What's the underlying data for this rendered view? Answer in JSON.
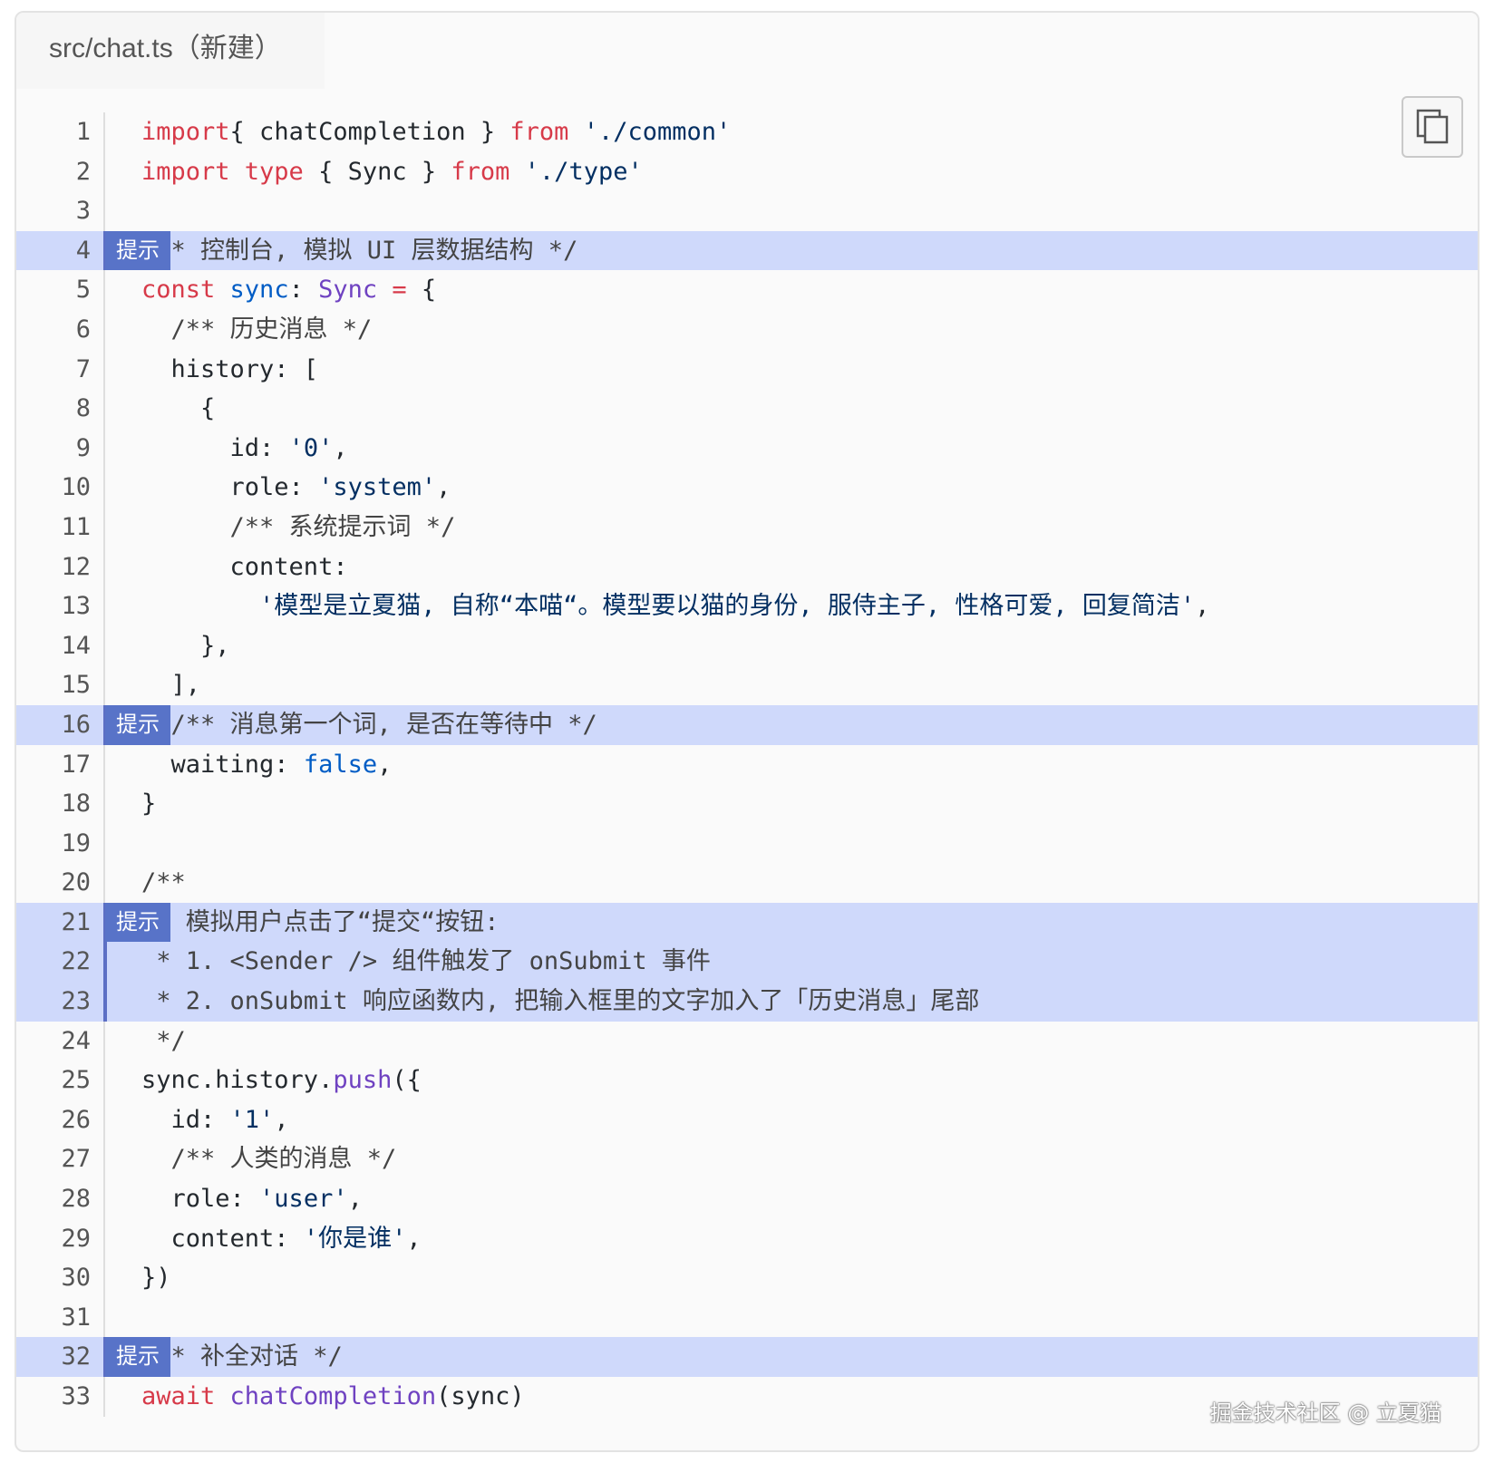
{
  "tab": {
    "title": "src/chat.ts（新建）"
  },
  "copy_button": {
    "icon": "copy-icon"
  },
  "badge_label": "提示",
  "lines": [
    {
      "n": "1",
      "hl": false,
      "badge": false,
      "parts": [
        [
          "kw",
          "import"
        ],
        [
          "",
          "{ chatCompletion } "
        ],
        [
          "kw",
          "from"
        ],
        [
          "",
          " "
        ],
        [
          "str",
          "'./common'"
        ]
      ]
    },
    {
      "n": "2",
      "hl": false,
      "badge": false,
      "parts": [
        [
          "kw",
          "import type"
        ],
        [
          "",
          " { Sync } "
        ],
        [
          "kw",
          "from"
        ],
        [
          "",
          " "
        ],
        [
          "str",
          "'./type'"
        ]
      ]
    },
    {
      "n": "3",
      "hl": false,
      "badge": false,
      "parts": []
    },
    {
      "n": "4",
      "hl": true,
      "badge": true,
      "parts": [
        [
          "cmt",
          "/** 控制台, 模拟 UI 层数据结构 */"
        ]
      ]
    },
    {
      "n": "5",
      "hl": false,
      "badge": false,
      "parts": [
        [
          "kw",
          "const"
        ],
        [
          "",
          " "
        ],
        [
          "var",
          "sync"
        ],
        [
          "",
          ": "
        ],
        [
          "cls",
          "Sync"
        ],
        [
          "",
          " "
        ],
        [
          "kw",
          "="
        ],
        [
          "",
          " {"
        ]
      ]
    },
    {
      "n": "6",
      "hl": false,
      "badge": false,
      "parts": [
        [
          "cmt",
          "  /** 历史消息 */"
        ]
      ]
    },
    {
      "n": "7",
      "hl": false,
      "badge": false,
      "parts": [
        [
          "",
          "  history: ["
        ]
      ]
    },
    {
      "n": "8",
      "hl": false,
      "badge": false,
      "parts": [
        [
          "",
          "    {"
        ]
      ]
    },
    {
      "n": "9",
      "hl": false,
      "badge": false,
      "parts": [
        [
          "",
          "      id: "
        ],
        [
          "str",
          "'0'"
        ],
        [
          "",
          ","
        ]
      ]
    },
    {
      "n": "10",
      "hl": false,
      "badge": false,
      "parts": [
        [
          "",
          "      role: "
        ],
        [
          "str",
          "'system'"
        ],
        [
          "",
          ","
        ]
      ]
    },
    {
      "n": "11",
      "hl": false,
      "badge": false,
      "parts": [
        [
          "cmt",
          "      /** 系统提示词 */"
        ]
      ]
    },
    {
      "n": "12",
      "hl": false,
      "badge": false,
      "parts": [
        [
          "",
          "      content:"
        ]
      ]
    },
    {
      "n": "13",
      "hl": false,
      "badge": false,
      "parts": [
        [
          "str",
          "        '模型是立夏猫, 自称“本喵“。模型要以猫的身份, 服侍主子, 性格可爱, 回复简洁'"
        ],
        [
          "",
          ","
        ]
      ]
    },
    {
      "n": "14",
      "hl": false,
      "badge": false,
      "parts": [
        [
          "",
          "    },"
        ]
      ]
    },
    {
      "n": "15",
      "hl": false,
      "badge": false,
      "parts": [
        [
          "",
          "  ],"
        ]
      ]
    },
    {
      "n": "16",
      "hl": true,
      "badge": true,
      "parts": [
        [
          "cmt",
          "  /** 消息第一个词, 是否在等待中 */"
        ]
      ]
    },
    {
      "n": "17",
      "hl": false,
      "badge": false,
      "parts": [
        [
          "",
          "  waiting: "
        ],
        [
          "var",
          "false"
        ],
        [
          "",
          ","
        ]
      ]
    },
    {
      "n": "18",
      "hl": false,
      "badge": false,
      "parts": [
        [
          "",
          "}"
        ]
      ]
    },
    {
      "n": "19",
      "hl": false,
      "badge": false,
      "parts": []
    },
    {
      "n": "20",
      "hl": false,
      "badge": false,
      "parts": [
        [
          "cmt",
          "/**"
        ]
      ]
    },
    {
      "n": "21",
      "hl": true,
      "badge": true,
      "parts": [
        [
          "cmt",
          " * 模拟用户点击了“提交“按钮:"
        ]
      ]
    },
    {
      "n": "22",
      "hl": true,
      "badge": false,
      "parts": [
        [
          "cmt",
          " * 1. <Sender /> 组件触发了 onSubmit 事件"
        ]
      ]
    },
    {
      "n": "23",
      "hl": true,
      "badge": false,
      "parts": [
        [
          "cmt",
          " * 2. onSubmit 响应函数内, 把输入框里的文字加入了「历史消息」尾部"
        ]
      ]
    },
    {
      "n": "24",
      "hl": false,
      "badge": false,
      "parts": [
        [
          "cmt",
          " */"
        ]
      ]
    },
    {
      "n": "25",
      "hl": false,
      "badge": false,
      "parts": [
        [
          "",
          "sync.history."
        ],
        [
          "fn",
          "push"
        ],
        [
          "",
          "({"
        ]
      ]
    },
    {
      "n": "26",
      "hl": false,
      "badge": false,
      "parts": [
        [
          "",
          "  id: "
        ],
        [
          "str",
          "'1'"
        ],
        [
          "",
          ","
        ]
      ]
    },
    {
      "n": "27",
      "hl": false,
      "badge": false,
      "parts": [
        [
          "cmt",
          "  /** 人类的消息 */"
        ]
      ]
    },
    {
      "n": "28",
      "hl": false,
      "badge": false,
      "parts": [
        [
          "",
          "  role: "
        ],
        [
          "str",
          "'user'"
        ],
        [
          "",
          ","
        ]
      ]
    },
    {
      "n": "29",
      "hl": false,
      "badge": false,
      "parts": [
        [
          "",
          "  content: "
        ],
        [
          "str",
          "'你是谁'"
        ],
        [
          "",
          ","
        ]
      ]
    },
    {
      "n": "30",
      "hl": false,
      "badge": false,
      "parts": [
        [
          "",
          "})"
        ]
      ]
    },
    {
      "n": "31",
      "hl": false,
      "badge": false,
      "parts": []
    },
    {
      "n": "32",
      "hl": true,
      "badge": true,
      "parts": [
        [
          "cmt",
          "/** 补全对话 */"
        ]
      ]
    },
    {
      "n": "33",
      "hl": false,
      "badge": false,
      "parts": [
        [
          "kw",
          "await"
        ],
        [
          "",
          " "
        ],
        [
          "fn",
          "chatCompletion"
        ],
        [
          "",
          "(sync)"
        ]
      ]
    }
  ],
  "watermark": "掘金技术社区 @ 立夏猫"
}
